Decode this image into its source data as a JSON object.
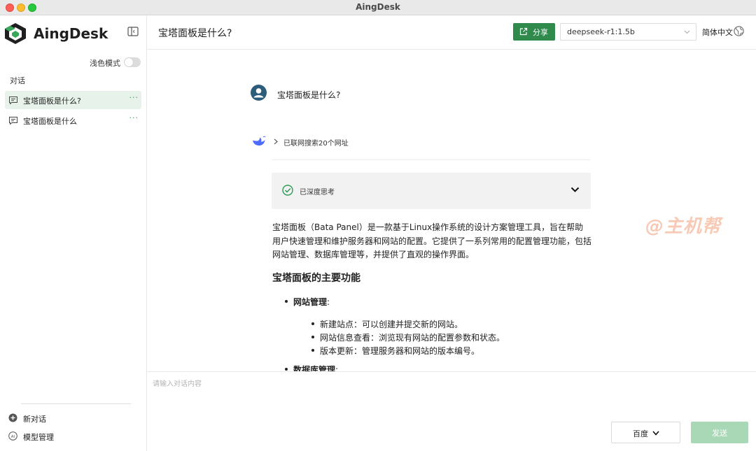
{
  "window": {
    "title": "AingDesk"
  },
  "sidebar": {
    "brand": "AingDesk",
    "light_mode_label": "浅色模式",
    "section_label": "对话",
    "conversations": [
      {
        "label": "宝塔面板是什么?",
        "active": true,
        "more": "···"
      },
      {
        "label": "宝塔面板是什么",
        "active": false,
        "more": "···"
      }
    ],
    "new_chat_label": "新对话",
    "model_manage_label": "模型管理"
  },
  "header": {
    "title": "宝塔面板是什么?",
    "share_label": "分享",
    "model_value": "deepseek-r1:1.5b",
    "language_label": "简体中文"
  },
  "chat": {
    "user_question": "宝塔面板是什么?",
    "web_search_label": "已联网搜索20个网址",
    "thinking_label": "已深度思考",
    "answer_intro": "宝塔面板（Bata Panel）是一款基于Linux操作系统的设计方案管理工具，旨在帮助用户快速管理和维护服务器和网站的配置。它提供了一系列常用的配置管理功能，包括网站管理、数据库管理等，并提供了直观的操作界面。",
    "answer_heading": "宝塔面板的主要功能",
    "features": [
      {
        "title": "网站管理",
        "suffix": ":",
        "items": [
          "新建站点：可以创建并提交新的网站。",
          "网站信息查看：浏览现有网站的配置参数和状态。",
          "版本更新：管理服务器和网站的版本编号。"
        ]
      },
      {
        "title": "数据库管理",
        "suffix": ":",
        "items": []
      }
    ]
  },
  "input": {
    "placeholder": "请输入对话内容",
    "search_engine": "百度",
    "send_label": "发送"
  },
  "watermark": "@主机帮",
  "colors": {
    "accent": "#2f8a4c",
    "active_bg": "#e7f2ea",
    "send_disabled": "#a9d8b7",
    "avatar": "#2d5d7b"
  }
}
